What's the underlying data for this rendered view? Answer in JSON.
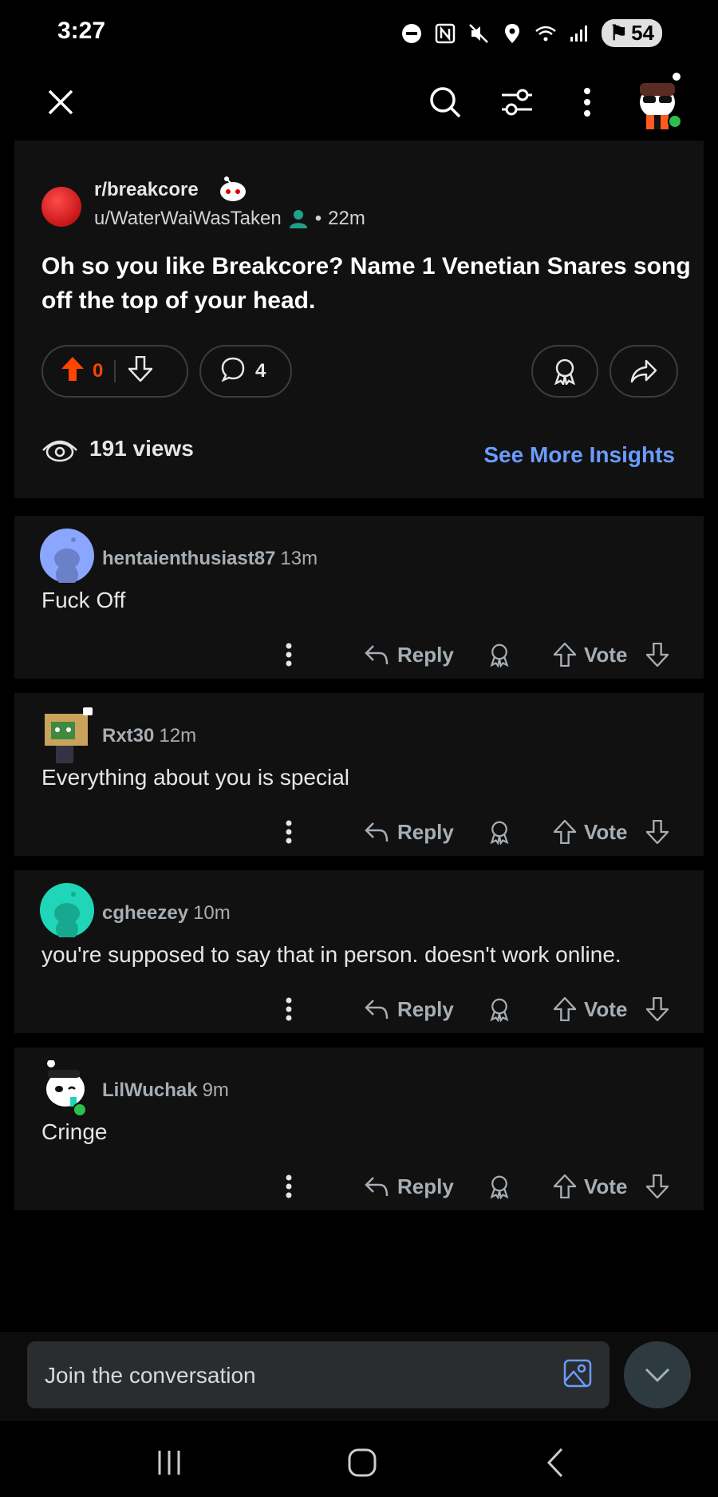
{
  "status_bar": {
    "time": "3:27",
    "battery": "54",
    "icons": [
      "do-not-disturb-icon",
      "nfc-icon",
      "mute-icon",
      "location-icon",
      "wifi-icon",
      "signal-icon"
    ]
  },
  "top_bar": {
    "icons": [
      "close-icon",
      "search-icon",
      "sort-icon",
      "more-vertical-icon",
      "user-avatar"
    ]
  },
  "post": {
    "subreddit": "r/breakcore",
    "author": "u/WaterWaiWasTaken",
    "separator": "•",
    "age": "22m",
    "title": "Oh so you like Breakcore? Name 1 Venetian Snares song off the top of your head.",
    "upvotes": "0",
    "comments": "4",
    "views": "191 views",
    "insights_link": "See More Insights"
  },
  "comments": [
    {
      "user": "hentaienthusiast87",
      "time": "13m",
      "text": "Fuck Off",
      "reply": "Reply",
      "vote": "Vote"
    },
    {
      "user": "Rxt30",
      "time": "12m",
      "text": "Everything about you is special",
      "reply": "Reply",
      "vote": "Vote"
    },
    {
      "user": "cgheezey",
      "time": "10m",
      "text": "you're supposed to say that in person. doesn't work online.",
      "reply": "Reply",
      "vote": "Vote"
    },
    {
      "user": "LilWuchak",
      "time": "9m",
      "text": "Cringe",
      "reply": "Reply",
      "vote": "Vote"
    }
  ],
  "composer": {
    "placeholder": "Join the conversation"
  },
  "colors": {
    "upvote_orange": "#ff4500",
    "link_blue": "#6a9cff",
    "card_bg": "#111111",
    "page_bg": "#000000"
  }
}
